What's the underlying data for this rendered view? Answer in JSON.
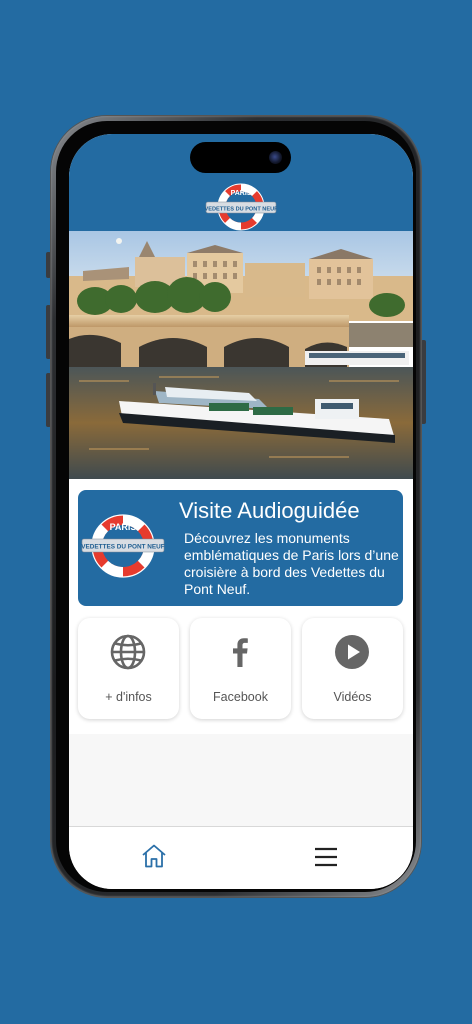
{
  "app": {
    "brand_logo": {
      "top_text": "PARIS",
      "band_text": "VEDETTES DU PONT NEUF"
    }
  },
  "colors": {
    "brand_blue": "#236ba2",
    "tile_icon_gray": "#666666",
    "tab_active_blue": "#2a6fa8"
  },
  "hero_image": {
    "subject": "tour boat on the Seine by Pont Neuf"
  },
  "info_card": {
    "title": "Visite Audioguidée",
    "description": "Découvrez les monuments emblématiques de Paris lors d’une croisière à bord des Vedettes du Pont Neuf."
  },
  "tiles": [
    {
      "icon": "globe-icon",
      "label": "+ d'infos"
    },
    {
      "icon": "facebook-icon",
      "label": "Facebook"
    },
    {
      "icon": "play-circle-icon",
      "label": "Vidéos"
    }
  ],
  "tabbar": {
    "items": [
      {
        "icon": "home-icon",
        "active": true
      },
      {
        "icon": "menu-icon",
        "active": false
      }
    ]
  }
}
